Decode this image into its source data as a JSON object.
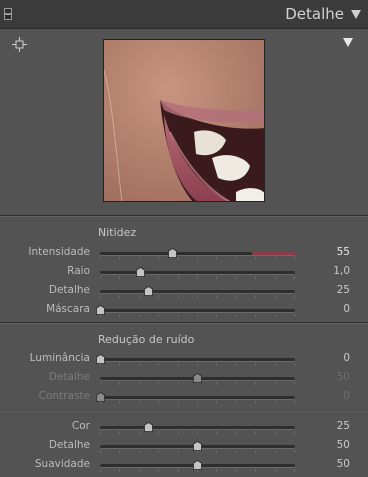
{
  "header": {
    "title": "Detalhe"
  },
  "preview": {
    "image_desc": "close-up-lips-teeth"
  },
  "sharpening": {
    "title": "Nitidez",
    "rows": [
      {
        "label": "Intensidade",
        "value": "55",
        "fraction": 0.37,
        "dim": false,
        "highlight": true
      },
      {
        "label": "Raio",
        "value": "1,0",
        "fraction": 0.21,
        "dim": false,
        "highlight": false
      },
      {
        "label": "Detalhe",
        "value": "25",
        "fraction": 0.25,
        "dim": false,
        "highlight": false
      },
      {
        "label": "Máscara",
        "value": "0",
        "fraction": 0.0,
        "dim": false,
        "highlight": false
      }
    ]
  },
  "noise": {
    "title": "Redução de ruído",
    "rows": [
      {
        "label": "Luminância",
        "value": "0",
        "fraction": 0.0,
        "dim": false,
        "highlight": false
      },
      {
        "label": "Detalhe",
        "value": "50",
        "fraction": 0.5,
        "dim": true,
        "highlight": false
      },
      {
        "label": "Contraste",
        "value": "0",
        "fraction": 0.0,
        "dim": true,
        "highlight": false
      }
    ],
    "color_rows": [
      {
        "label": "Cor",
        "value": "25",
        "fraction": 0.25,
        "dim": false,
        "highlight": false
      },
      {
        "label": "Detalhe",
        "value": "50",
        "fraction": 0.5,
        "dim": false,
        "highlight": false
      },
      {
        "label": "Suavidade",
        "value": "50",
        "fraction": 0.5,
        "dim": false,
        "highlight": false
      }
    ]
  },
  "colors": {
    "panel_bg": "#535353",
    "header_bg": "#3b3b3b",
    "accent_red": "#8a3d46"
  }
}
